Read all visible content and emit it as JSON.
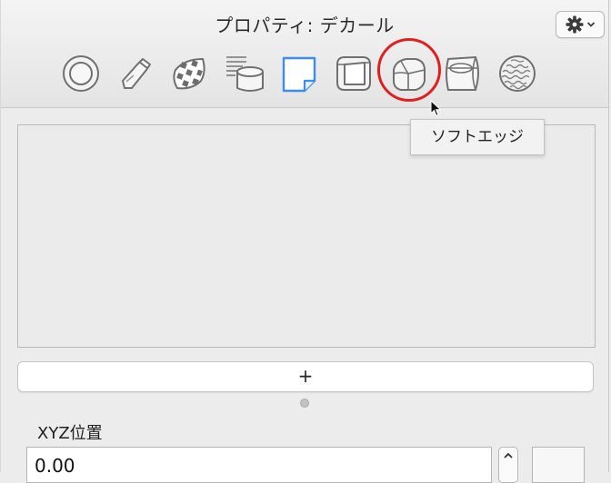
{
  "window": {
    "title": "プロパティ: デカール"
  },
  "toolbar": {
    "tabs": [
      {
        "name": "tab-rings",
        "icon": "rings-icon"
      },
      {
        "name": "tab-tube",
        "icon": "tube-icon"
      },
      {
        "name": "tab-checker-texture",
        "icon": "checker-texture-icon"
      },
      {
        "name": "tab-list-cylinder",
        "icon": "list-cylinder-icon"
      },
      {
        "name": "tab-decal",
        "icon": "decal-note-icon",
        "selected": true
      },
      {
        "name": "tab-rounded-box",
        "icon": "rounded-box-icon"
      },
      {
        "name": "tab-soft-edge",
        "icon": "soft-edge-icon",
        "hovered": true
      },
      {
        "name": "tab-panel-sphere",
        "icon": "panel-sphere-icon"
      },
      {
        "name": "tab-bumpy-ball",
        "icon": "bumpy-ball-icon"
      }
    ],
    "gear_menu_icon": "gear-icon",
    "accent_color": "#3b8cf5",
    "highlight_color": "#e0201f"
  },
  "tooltip": {
    "text": "ソフトエッジ"
  },
  "content": {
    "add_label": "+",
    "xyz_label": "XYZ位置",
    "x_value": "0.00"
  }
}
